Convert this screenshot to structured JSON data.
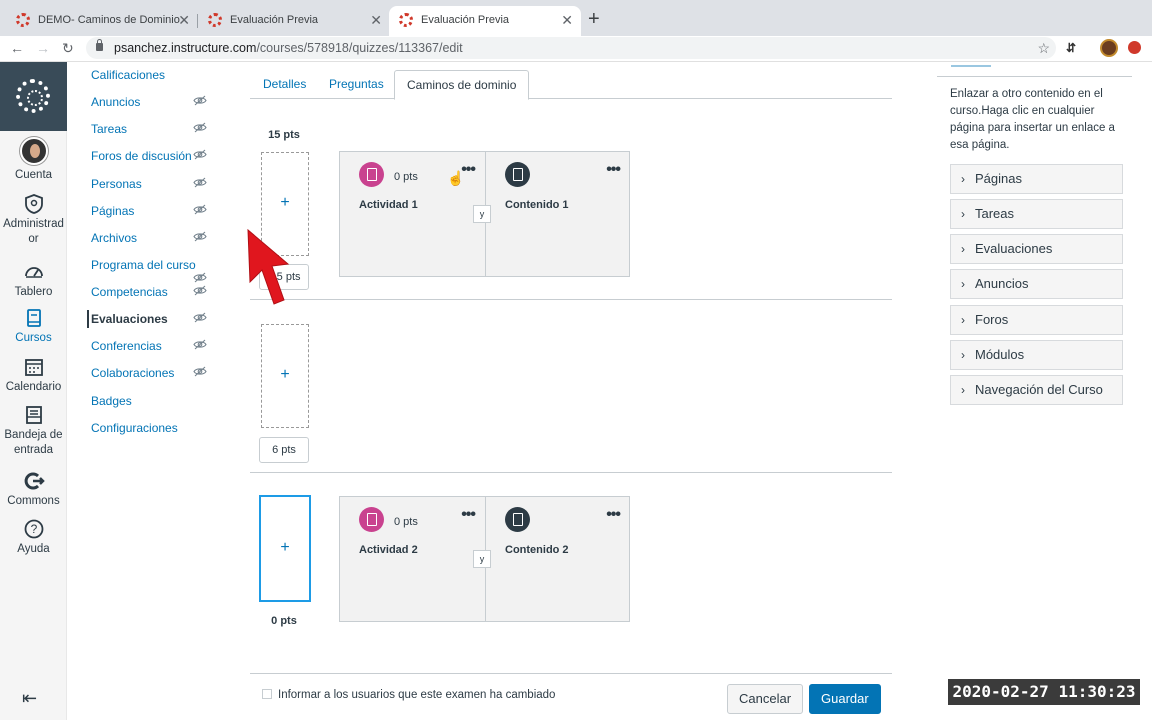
{
  "browser": {
    "tabs": [
      {
        "title": "DEMO- Caminos de Dominio"
      },
      {
        "title": "Evaluación Previa"
      },
      {
        "title": "Evaluación Previa"
      }
    ],
    "url_host": "psanchez.instructure.com",
    "url_path": "/courses/578918/quizzes/113367/edit"
  },
  "global_nav": {
    "items": [
      {
        "label": "Cuenta",
        "icon": "avatar"
      },
      {
        "label": "Administrad or",
        "icon": "shield-icon"
      },
      {
        "label": "Tablero",
        "icon": "dashboard-icon"
      },
      {
        "label": "Cursos",
        "icon": "book-icon"
      },
      {
        "label": "Calendario",
        "icon": "calendar-icon"
      },
      {
        "label": "Bandeja de entrada",
        "icon": "inbox-icon"
      },
      {
        "label": "Commons",
        "icon": "commons-icon"
      },
      {
        "label": "Ayuda",
        "icon": "help-icon"
      }
    ]
  },
  "course_nav": {
    "items": [
      {
        "label": "Calificaciones"
      },
      {
        "label": "Anuncios"
      },
      {
        "label": "Tareas"
      },
      {
        "label": "Foros de discusión"
      },
      {
        "label": "Personas"
      },
      {
        "label": "Páginas"
      },
      {
        "label": "Archivos"
      },
      {
        "label": "Programa del curso"
      },
      {
        "label": "Competencias"
      },
      {
        "label": "Evaluaciones"
      },
      {
        "label": "Conferencias"
      },
      {
        "label": "Colaboraciones"
      },
      {
        "label": "Badges"
      },
      {
        "label": "Configuraciones"
      }
    ]
  },
  "tabs": {
    "detalles": "Detalles",
    "preguntas": "Preguntas",
    "caminos": "Caminos de dominio"
  },
  "paths": {
    "top_score": "15 pts",
    "range1_points": "0.5 pts",
    "range2_points": "6 pts",
    "range3_points": "0 pts",
    "row1": {
      "left": {
        "pts": "0 pts",
        "title": "Actividad 1"
      },
      "right": {
        "title": "Contenido 1"
      },
      "connector": "y"
    },
    "row3": {
      "left": {
        "pts": "0 pts",
        "title": "Actividad 2"
      },
      "right": {
        "title": "Contenido 2"
      },
      "connector": "y"
    }
  },
  "footer": {
    "notify_label": "Informar a los usuarios que este examen ha cambiado",
    "cancel": "Cancelar",
    "save": "Guardar"
  },
  "right_panel": {
    "description": "Enlazar a otro contenido en el curso.Haga clic en cualquier página para insertar un enlace a esa página.",
    "sections": [
      "Páginas",
      "Tareas",
      "Evaluaciones",
      "Anuncios",
      "Foros",
      "Módulos",
      "Navegación del Curso"
    ]
  },
  "overlay": {
    "timestamp": "2020-02-27 11:30:23"
  }
}
